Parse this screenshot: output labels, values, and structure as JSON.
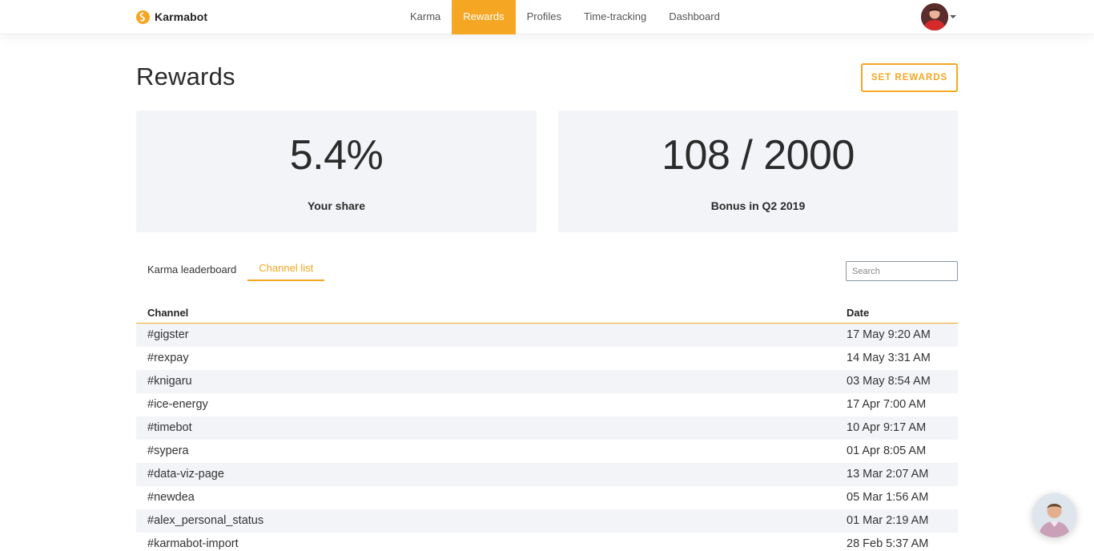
{
  "header": {
    "brand": "Karmabot",
    "nav": [
      {
        "label": "Karma",
        "active": false
      },
      {
        "label": "Rewards",
        "active": true
      },
      {
        "label": "Profiles",
        "active": false
      },
      {
        "label": "Time-tracking",
        "active": false
      },
      {
        "label": "Dashboard",
        "active": false
      }
    ]
  },
  "page": {
    "title": "Rewards",
    "set_rewards_label": "SET REWARDS"
  },
  "stats": [
    {
      "value": "5.4%",
      "label": "Your share"
    },
    {
      "value": "108 / 2000",
      "label": "Bonus in Q2 2019"
    }
  ],
  "tabs": [
    {
      "label": "Karma leaderboard",
      "active": false
    },
    {
      "label": "Channel list",
      "active": true
    }
  ],
  "search": {
    "placeholder": "Search",
    "value": ""
  },
  "table": {
    "columns": [
      "Channel",
      "Date"
    ],
    "rows": [
      {
        "channel": "#gigster",
        "date": "17 May 9:20 AM"
      },
      {
        "channel": "#rexpay",
        "date": "14 May 3:31 AM"
      },
      {
        "channel": "#knigaru",
        "date": "03 May 8:54 AM"
      },
      {
        "channel": "#ice-energy",
        "date": "17 Apr 7:00 AM"
      },
      {
        "channel": "#timebot",
        "date": "10 Apr 9:17 AM"
      },
      {
        "channel": "#sypera",
        "date": "01 Apr 8:05 AM"
      },
      {
        "channel": "#data-viz-page",
        "date": "13 Mar 2:07 AM"
      },
      {
        "channel": "#newdea",
        "date": "05 Mar 1:56 AM"
      },
      {
        "channel": "#alex_personal_status",
        "date": "01 Mar 2:19 AM"
      },
      {
        "channel": "#karmabot-import",
        "date": "28 Feb 5:37 AM"
      }
    ]
  },
  "colors": {
    "accent": "#f5a623",
    "card_bg": "#f2f4f7",
    "stripe_bg": "#f2f4f7"
  },
  "icons": {
    "logo": "karmabot-logo-icon",
    "user_avatar": "user-avatar",
    "menu_caret": "chevron-down-icon",
    "chat": "support-chat-avatar"
  }
}
